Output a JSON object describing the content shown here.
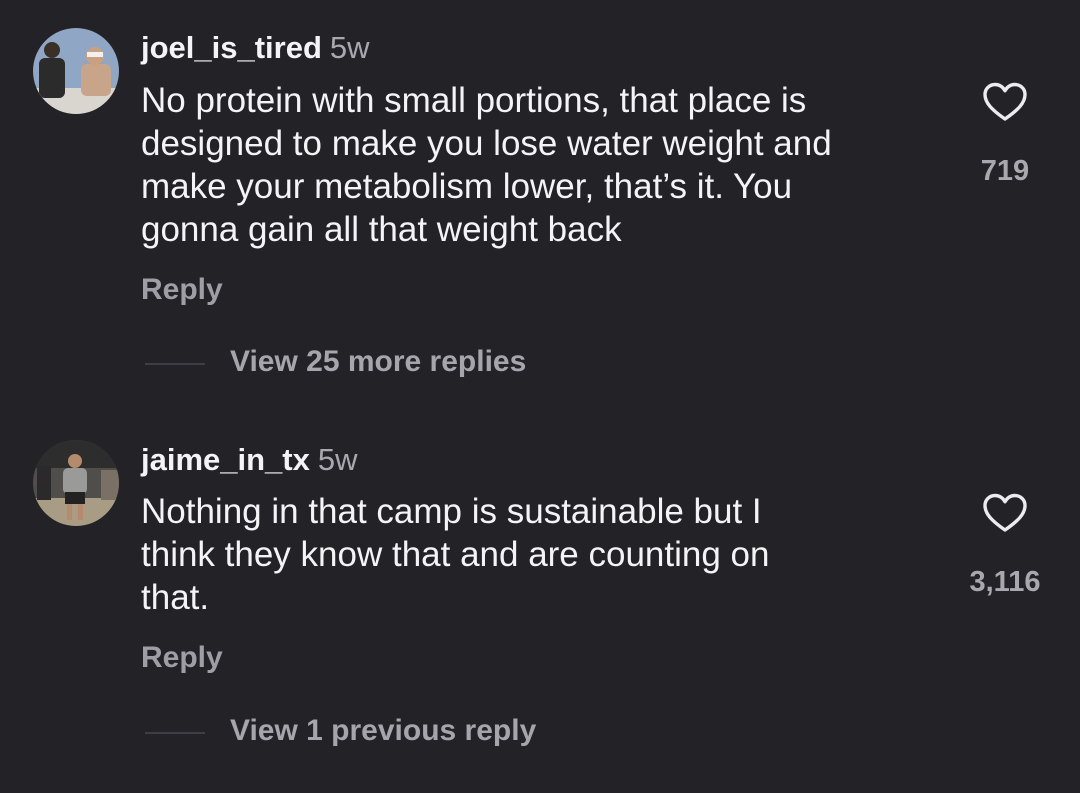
{
  "comments": [
    {
      "username": "joel_is_tired",
      "age": "5w",
      "text": "No protein with small portions, that place is\ndesigned to make you lose water weight and\nmake your metabolism lower, that’s it. You\ngonna gain all that weight back",
      "reply_label": "Reply",
      "like_count": "719",
      "view_replies_label": "View 25 more replies"
    },
    {
      "username": "jaime_in_tx",
      "age": "5w",
      "text": "Nothing in that camp is sustainable but I\nthink they know that and are counting on\nthat.",
      "reply_label": "Reply",
      "like_count": "3,116",
      "view_replies_label": "View 1 previous reply"
    }
  ],
  "icons": {
    "like": "heart-outline-icon"
  },
  "colors": {
    "background": "#232327",
    "primary_text": "#f4f4f6",
    "secondary_text": "#a8a8ae"
  }
}
